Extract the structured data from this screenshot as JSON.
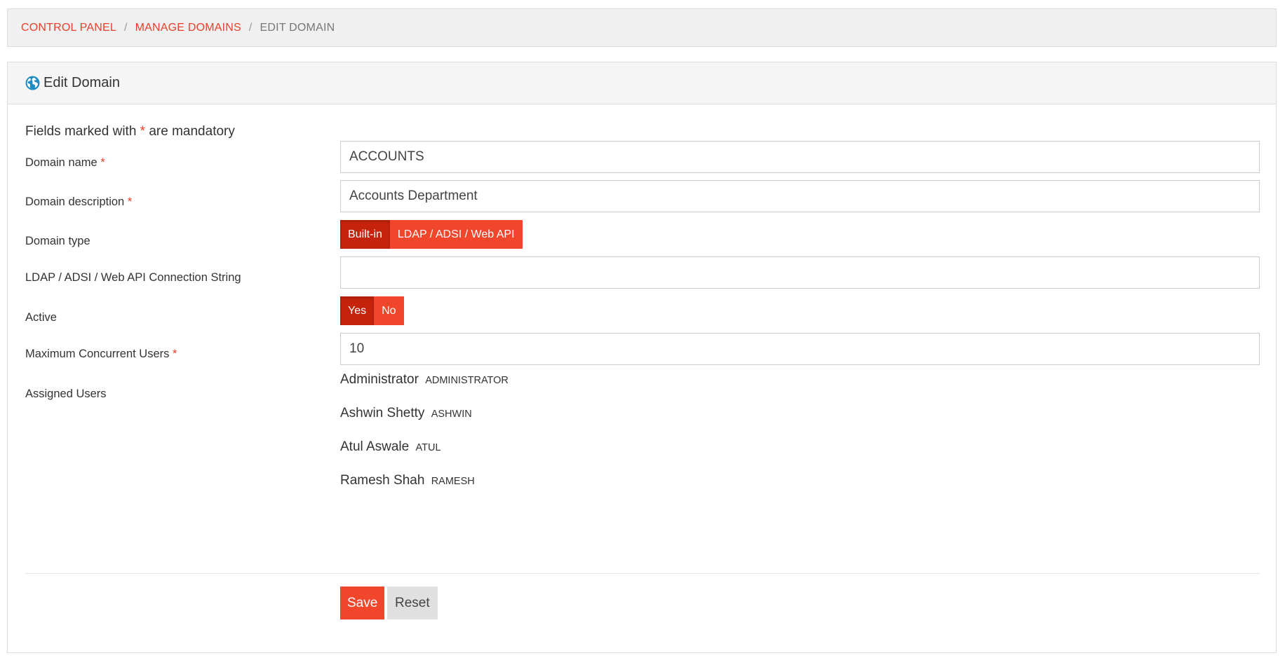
{
  "breadcrumb": {
    "items": [
      "CONTROL PANEL",
      "MANAGE DOMAINS"
    ],
    "separator": "/",
    "current": "EDIT DOMAIN"
  },
  "panel": {
    "title": "Edit Domain",
    "icon": "globe-icon"
  },
  "form": {
    "mandatory_note_prefix": "Fields marked with",
    "mandatory_note_star": "*",
    "mandatory_note_suffix": "are mandatory",
    "required_marker": "*",
    "domain_name": {
      "label": "Domain name",
      "value": "ACCOUNTS"
    },
    "domain_description": {
      "label": "Domain description",
      "value": "Accounts Department"
    },
    "domain_type": {
      "label": "Domain type",
      "options": [
        "Built-in",
        "LDAP / ADSI / Web API"
      ],
      "selected": "Built-in"
    },
    "connection_string": {
      "label": "LDAP / ADSI / Web API Connection String",
      "value": ""
    },
    "active": {
      "label": "Active",
      "options": [
        "Yes",
        "No"
      ],
      "selected": "Yes"
    },
    "max_users": {
      "label": "Maximum Concurrent Users",
      "value": "10"
    },
    "assigned_users": {
      "label": "Assigned Users",
      "users": [
        {
          "name": "Administrator",
          "code": "ADMINISTRATOR"
        },
        {
          "name": "Ashwin Shetty",
          "code": "ASHWIN"
        },
        {
          "name": "Atul Aswale",
          "code": "ATUL"
        },
        {
          "name": "Ramesh Shah",
          "code": "RAMESH"
        }
      ]
    }
  },
  "actions": {
    "save_label": "Save",
    "reset_label": "Reset"
  },
  "colors": {
    "accent": "#f2462c",
    "accent_active": "#c5230c",
    "link": "#e8402a",
    "icon_blue": "#1e8bc3"
  }
}
